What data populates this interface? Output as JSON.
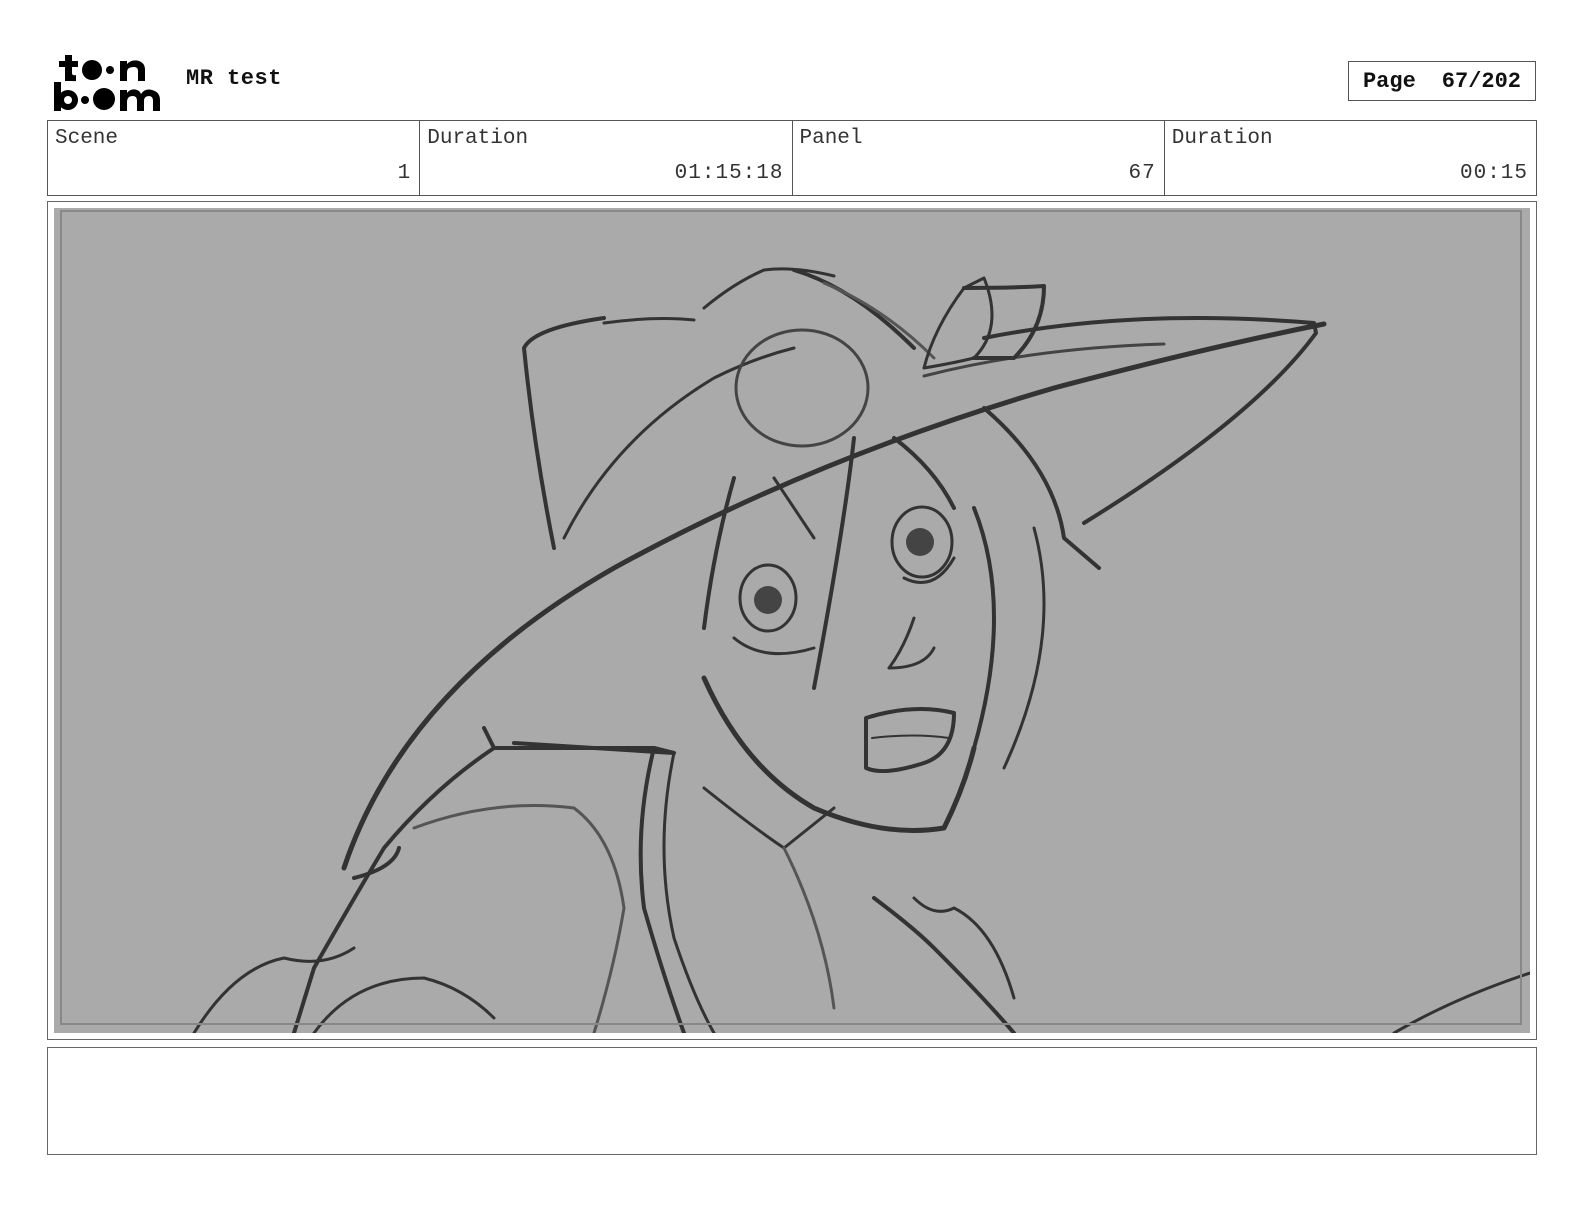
{
  "header": {
    "logo_name": "toonboom-logo",
    "project_title": "MR test",
    "page_label": "Page",
    "page_value": "67/202"
  },
  "info": {
    "scene_label": "Scene",
    "scene_value": "1",
    "scene_duration_label": "Duration",
    "scene_duration_value": "01:15:18",
    "panel_label": "Panel",
    "panel_value": "67",
    "panel_duration_label": "Duration",
    "panel_duration_value": "00:15"
  },
  "panel": {
    "background_color": "#aaaaaa",
    "stroke_color": "#333333"
  },
  "notes": {
    "text": ""
  }
}
